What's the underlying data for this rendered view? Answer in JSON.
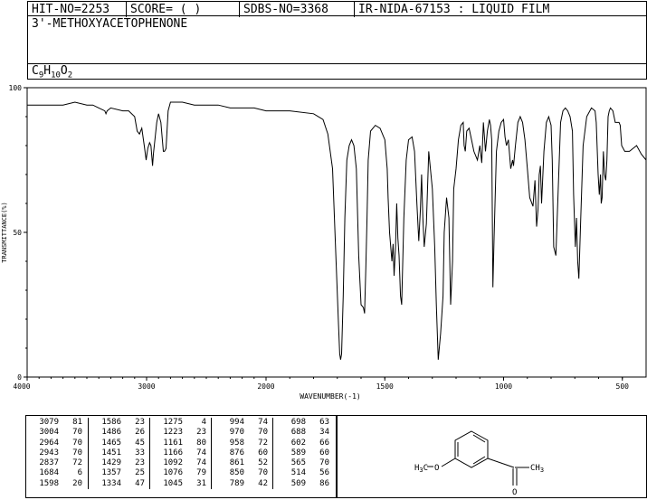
{
  "header": {
    "hit_no": "HIT-NO=2253",
    "score": "SCORE=  (   )",
    "sdbs_no": "SDBS-NO=3368",
    "ir_code": "IR-NIDA-67153 : LIQUID FILM",
    "compound_name": "3'-METHOXYACETOPHENONE",
    "formula_C": "C",
    "formula_C_sub": "9",
    "formula_H": "H",
    "formula_H_sub": "10",
    "formula_O": "O",
    "formula_O_sub": "2"
  },
  "chart_data": {
    "type": "line",
    "xlabel": "WAVENUMBER(-1)",
    "ylabel": "TRANSMITTANCE(%)",
    "xlim": [
      4000,
      400
    ],
    "ylim": [
      0,
      100
    ],
    "x_ticks": [
      "4000",
      "3000",
      "2000",
      "1500",
      "1000",
      "500"
    ],
    "y_ticks": [
      "100",
      "50",
      "0"
    ],
    "series": [
      {
        "x": [
          4000,
          3900,
          3800,
          3700,
          3600,
          3500,
          3450,
          3400,
          3350,
          3340,
          3330,
          3300,
          3200,
          3150,
          3100,
          3079,
          3060,
          3040,
          3020,
          3004,
          2990,
          2975,
          2964,
          2950,
          2943,
          2930,
          2915,
          2900,
          2880,
          2860,
          2850,
          2837,
          2820,
          2800,
          2700,
          2600,
          2500,
          2400,
          2300,
          2200,
          2100,
          2000,
          1900,
          1800,
          1760,
          1740,
          1720,
          1705,
          1695,
          1690,
          1686,
          1682,
          1675,
          1668,
          1660,
          1650,
          1640,
          1630,
          1620,
          1610,
          1600,
          1590,
          1585,
          1580,
          1575,
          1570,
          1560,
          1540,
          1520,
          1500,
          1490,
          1486,
          1480,
          1470,
          1465,
          1461,
          1455,
          1450,
          1445,
          1440,
          1434,
          1429,
          1420,
          1410,
          1400,
          1385,
          1375,
          1365,
          1357,
          1350,
          1345,
          1340,
          1334,
          1325,
          1315,
          1300,
          1290,
          1283,
          1275,
          1265,
          1255,
          1250,
          1240,
          1230,
          1223,
          1215,
          1210,
          1200,
          1190,
          1180,
          1170,
          1166,
          1161,
          1155,
          1145,
          1135,
          1125,
          1110,
          1100,
          1092,
          1085,
          1076,
          1068,
          1060,
          1055,
          1050,
          1045,
          1040,
          1030,
          1020,
          1010,
          1000,
          994,
          988,
          980,
          970,
          962,
          958,
          950,
          940,
          930,
          920,
          910,
          900,
          890,
          876,
          868,
          861,
          855,
          850,
          845,
          840,
          830,
          820,
          810,
          800,
          795,
          789,
          780,
          770,
          760,
          750,
          740,
          730,
          720,
          710,
          705,
          698,
          693,
          688,
          683,
          675,
          665,
          650,
          630,
          615,
          610,
          602,
          597,
          592,
          589,
          585,
          580,
          575,
          570,
          565,
          560,
          555,
          550,
          540,
          530,
          514,
          509,
          503,
          490,
          470,
          440,
          420,
          400
        ],
        "y": [
          94,
          94,
          94,
          94,
          95,
          94,
          94,
          93,
          92,
          91,
          92,
          93,
          92,
          92,
          90,
          85,
          84,
          86,
          80,
          75,
          79,
          81,
          80,
          73,
          77,
          82,
          88,
          91,
          88,
          78,
          78,
          79,
          92,
          95,
          95,
          94,
          94,
          94,
          93,
          93,
          93,
          92,
          92,
          91,
          89,
          84,
          72,
          40,
          18,
          8,
          6,
          8,
          28,
          55,
          75,
          80,
          82,
          80,
          72,
          42,
          25,
          24,
          22,
          38,
          55,
          75,
          85,
          87,
          86,
          82,
          72,
          62,
          50,
          40,
          46,
          35,
          45,
          60,
          48,
          42,
          28,
          25,
          55,
          75,
          82,
          83,
          78,
          60,
          47,
          58,
          70,
          55,
          45,
          53,
          78,
          65,
          45,
          25,
          6,
          15,
          28,
          50,
          62,
          55,
          25,
          40,
          65,
          72,
          82,
          87,
          88,
          80,
          78,
          85,
          86,
          82,
          78,
          75,
          80,
          74,
          88,
          78,
          85,
          89,
          87,
          82,
          31,
          48,
          78,
          85,
          88,
          89,
          83,
          80,
          82,
          72,
          75,
          73,
          80,
          88,
          90,
          88,
          82,
          72,
          62,
          59,
          68,
          52,
          58,
          70,
          73,
          60,
          78,
          88,
          90,
          87,
          75,
          45,
          42,
          65,
          88,
          92,
          93,
          92,
          90,
          85,
          63,
          45,
          55,
          40,
          34,
          55,
          80,
          90,
          93,
          92,
          88,
          70,
          63,
          70,
          60,
          62,
          78,
          70,
          68,
          75,
          90,
          92,
          93,
          92,
          88,
          88,
          87,
          80,
          78,
          78,
          80,
          77,
          75
        ]
      }
    ]
  },
  "peak_table": {
    "col1": [
      [
        "3079",
        "81"
      ],
      [
        "3004",
        "70"
      ],
      [
        "2964",
        "70"
      ],
      [
        "2943",
        "70"
      ],
      [
        "2837",
        "72"
      ],
      [
        "1684",
        "6"
      ],
      [
        "1598",
        "20"
      ]
    ],
    "col2": [
      [
        "1586",
        "23"
      ],
      [
        "1486",
        "26"
      ],
      [
        "1465",
        "45"
      ],
      [
        "1451",
        "33"
      ],
      [
        "1429",
        "23"
      ],
      [
        "1357",
        "25"
      ],
      [
        "1334",
        "47"
      ]
    ],
    "col3": [
      [
        "1275",
        "4"
      ],
      [
        "1223",
        "23"
      ],
      [
        "1161",
        "80"
      ],
      [
        "1166",
        "74"
      ],
      [
        "1092",
        "74"
      ],
      [
        "1076",
        "79"
      ],
      [
        "1045",
        "31"
      ]
    ],
    "col4": [
      [
        "994",
        "74"
      ],
      [
        "970",
        "70"
      ],
      [
        "958",
        "72"
      ],
      [
        "876",
        "60"
      ],
      [
        "861",
        "52"
      ],
      [
        "850",
        "70"
      ],
      [
        "789",
        "42"
      ]
    ],
    "col5": [
      [
        "698",
        "63"
      ],
      [
        "688",
        "34"
      ],
      [
        "602",
        "66"
      ],
      [
        "589",
        "60"
      ],
      [
        "565",
        "70"
      ],
      [
        "514",
        "56"
      ],
      [
        "509",
        "86"
      ]
    ]
  },
  "structure": {
    "methyl_C": "H",
    "methyl_sub": "3",
    "methyl_tail": "C",
    "oxygen_label": "O"
  }
}
